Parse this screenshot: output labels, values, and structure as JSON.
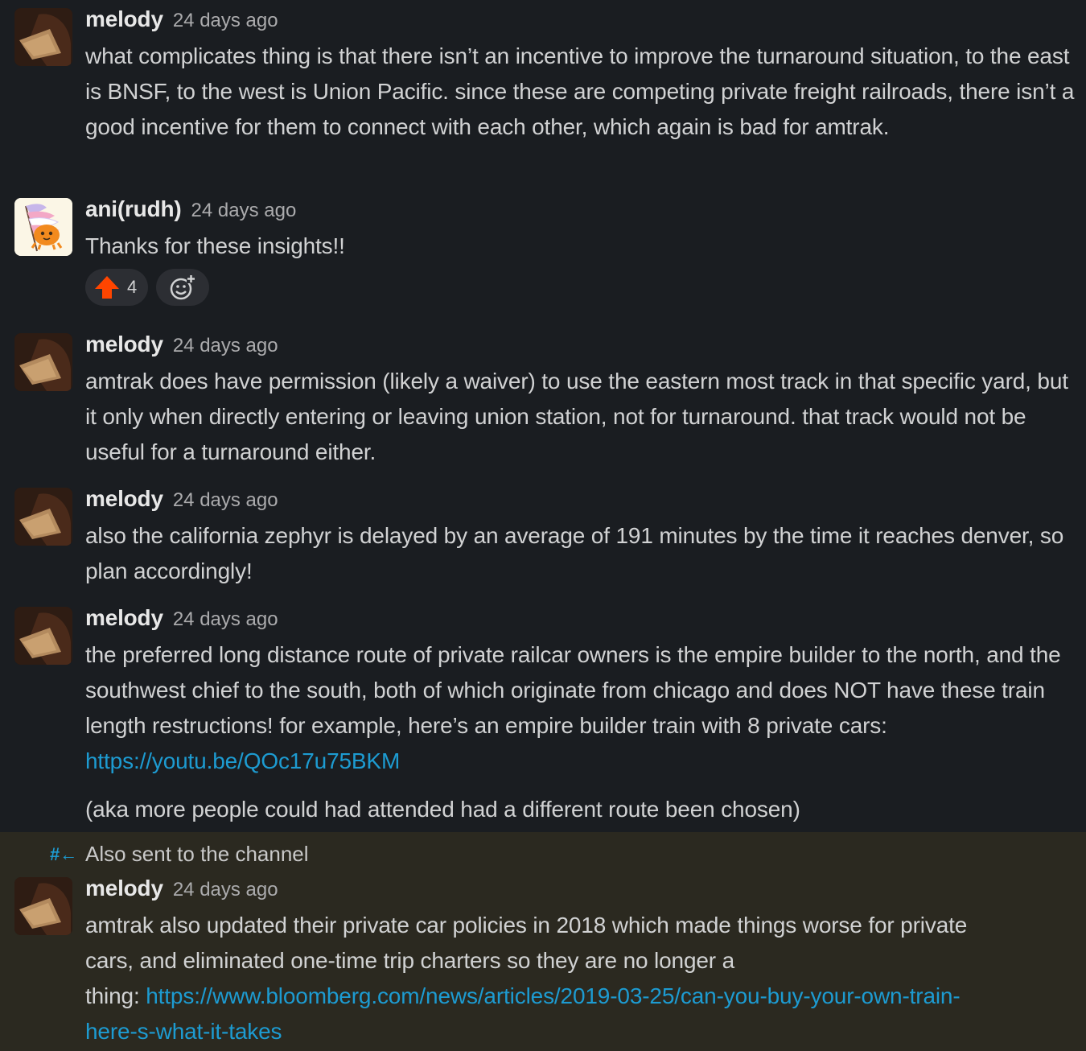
{
  "messages": [
    {
      "user": "melody",
      "time": "24 days ago",
      "text": "what complicates thing is that there isn’t an incentive to improve the turnaround situation, to the east is BNSF, to the west is Union Pacific. since these are competing private freight railroads, there isn’t a good incentive for them to connect with each other, which again is bad for amtrak."
    },
    {
      "user": "ani(rudh)",
      "time": "24 days ago",
      "text": "Thanks for these insights!!",
      "reactions": [
        {
          "emoji": "arrow-up-icon",
          "count": "4"
        }
      ]
    },
    {
      "user": "melody",
      "time": "24 days ago",
      "text": "amtrak does have permission (likely a waiver) to use the eastern most track in that specific yard, but it only when directly entering or leaving union station, not for turnaround. that track would not be useful for a turnaround either."
    },
    {
      "user": "melody",
      "time": "24 days ago",
      "text": "also the california zephyr is delayed by an average of 191 minutes by the time it reaches denver, so plan accordingly!"
    },
    {
      "user": "melody",
      "time": "24 days ago",
      "text": "the preferred long distance route of private railcar owners is the empire builder to the north, and the southwest chief to the south, both of which originate from chicago and does NOT have these train length restructions! for example, here’s an empire builder train with 8 private cars: ",
      "link": "https://youtu.be/QOc17u75BKM",
      "text2": "(aka more people could had attended had a different route been chosen)"
    },
    {
      "also_sent": "Also sent to the channel",
      "user": "melody",
      "time": "24 days ago",
      "text_line1": "amtrak also updated their private car policies in 2018 which made things worse for private",
      "text_line2": "cars, and eliminated one-time trip charters so they are no longer a",
      "text_line3": "thing: ",
      "link": "https://www.bloomberg.com/news/articles/2019-03-25/can-you-buy-your-own-train-",
      "link2": "here-s-what-it-takes"
    }
  ],
  "colors": {
    "background": "#1a1d21",
    "highlight": "#2b2920",
    "link": "#1d9bd1",
    "upvote": "#ff4500"
  }
}
